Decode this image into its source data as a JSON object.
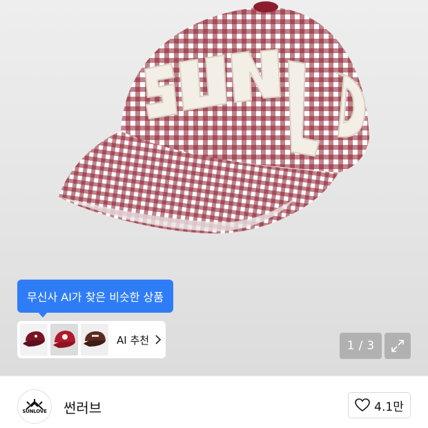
{
  "product": {
    "image_alt": "gingham baseball cap",
    "colors": {
      "check": "#8c1d2e",
      "light": "#ffffff",
      "patch": "#f3efe6"
    }
  },
  "ai_tooltip": {
    "text": "무신사 AI가 찾은 비슷한 상품"
  },
  "similar_products": {
    "thumbnails": [
      {
        "name": "burgundy cap",
        "color": "#7a1424"
      },
      {
        "name": "red cap",
        "color": "#b01a2c"
      },
      {
        "name": "brown cap",
        "color": "#5a2a1e"
      }
    ],
    "ai_label": "AI 추천",
    "chevron_icon": "chevron-right-icon"
  },
  "gallery": {
    "current": "1",
    "separator": "/",
    "total": "3",
    "expand_icon": "expand-icon"
  },
  "brand": {
    "logo_text": "SUNLOVE",
    "name": "썬러브"
  },
  "like": {
    "icon": "heart-icon",
    "count": "4.1만"
  },
  "colors": {
    "accent": "#2f7df6",
    "overlay": "#8c8c8c"
  }
}
